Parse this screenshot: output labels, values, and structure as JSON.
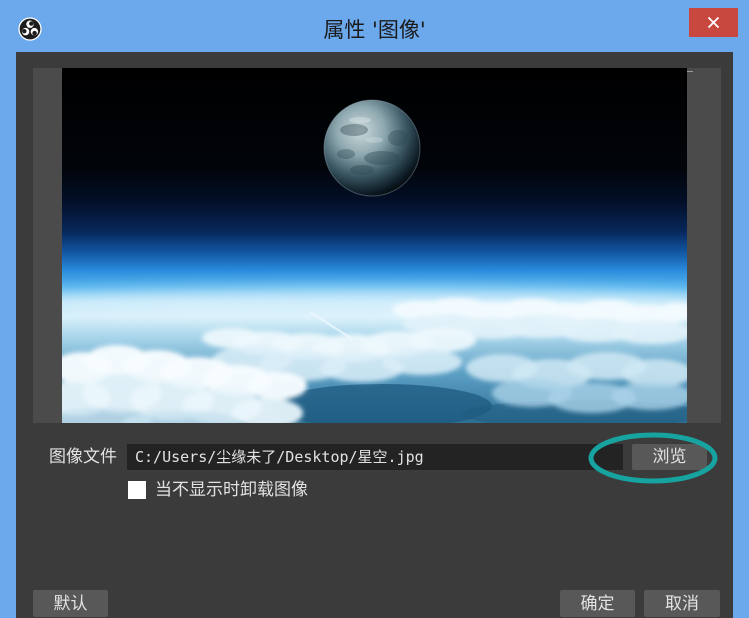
{
  "window": {
    "title": "属性 '图像'",
    "app_icon": "obs-logo-icon",
    "close_icon": "close-icon"
  },
  "form": {
    "file_label": "图像文件",
    "file_path": "C:/Users/尘缘未了/Desktop/星空.jpg",
    "browse_label": "浏览",
    "unload_checkbox_label": "当不显示时卸载图像",
    "unload_checked": false
  },
  "footer": {
    "defaults_label": "默认",
    "ok_label": "确定",
    "cancel_label": "取消"
  },
  "colors": {
    "frame": "#6ba8ec",
    "close_button": "#c8473f",
    "dialog_bg": "#3b3b3b",
    "preview_bg": "#4b4b4b",
    "input_bg": "#232323",
    "button_bg": "#585858",
    "text": "#e2e2e2",
    "title_text": "#1b1b1b",
    "highlight_annotation": "#17a3a0",
    "checkbox": "#ffffff"
  }
}
